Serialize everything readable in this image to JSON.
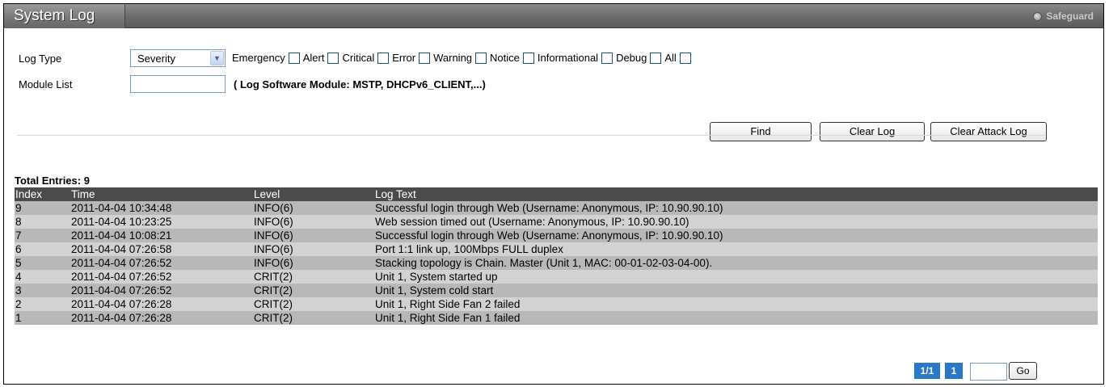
{
  "header": {
    "title": "System Log",
    "safeguard_label": "Safeguard"
  },
  "filters": {
    "log_type_label": "Log Type",
    "log_type_selected": "Severity",
    "severities": [
      "Emergency",
      "Alert",
      "Critical",
      "Error",
      "Warning",
      "Notice",
      "Informational",
      "Debug",
      "All"
    ],
    "module_list_label": "Module List",
    "module_list_value": "",
    "module_hint": "( Log Software Module: MSTP, DHCPv6_CLIENT,...)"
  },
  "actions": {
    "find": "Find",
    "clear_log": "Clear Log",
    "clear_attack_log": "Clear Attack Log"
  },
  "table": {
    "total_entries": "Total Entries: 9",
    "columns": [
      "Index",
      "Time",
      "Level",
      "Log Text"
    ],
    "rows": [
      [
        "9",
        "2011-04-04 10:34:48",
        "INFO(6)",
        "Successful login through Web (Username: Anonymous, IP: 10.90.90.10)"
      ],
      [
        "8",
        "2011-04-04 10:23:25",
        "INFO(6)",
        "Web session timed out (Username: Anonymous, IP: 10.90.90.10)"
      ],
      [
        "7",
        "2011-04-04 10:08:21",
        "INFO(6)",
        "Successful login through Web (Username: Anonymous, IP: 10.90.90.10)"
      ],
      [
        "6",
        "2011-04-04 07:26:58",
        "INFO(6)",
        "Port 1:1 link up, 100Mbps FULL duplex"
      ],
      [
        "5",
        "2011-04-04 07:26:52",
        "INFO(6)",
        "Stacking topology is Chain. Master (Unit 1, MAC: 00-01-02-03-04-00)."
      ],
      [
        "4",
        "2011-04-04 07:26:52",
        "CRIT(2)",
        "Unit 1, System started up"
      ],
      [
        "3",
        "2011-04-04 07:26:52",
        "CRIT(2)",
        "Unit 1, System cold start"
      ],
      [
        "2",
        "2011-04-04 07:26:28",
        "CRIT(2)",
        "Unit 1, Right Side Fan 2 failed"
      ],
      [
        "1",
        "2011-04-04 07:26:28",
        "CRIT(2)",
        "Unit 1, Right Side Fan 1 failed"
      ]
    ]
  },
  "pagination": {
    "page_of": "1/1",
    "current_page": "1",
    "go_label": "Go"
  }
}
